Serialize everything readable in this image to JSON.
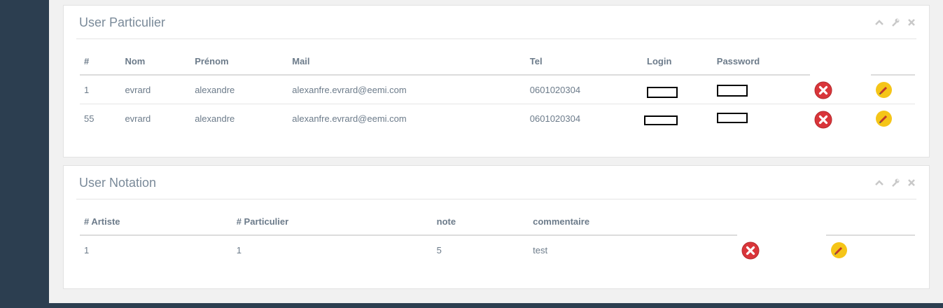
{
  "panels": [
    {
      "title": "User Particulier",
      "tools": [
        "chevron-up-icon",
        "wrench-icon",
        "close-icon"
      ],
      "columns": [
        "#",
        "Nom",
        "Prénom",
        "Mail",
        "Tel",
        "Login",
        "Password"
      ],
      "rows": [
        {
          "id": "1",
          "nom": "evrard",
          "prenom": "alexandre",
          "mail": "alexanfre.evrard@eemi.com",
          "tel": "0601020304"
        },
        {
          "id": "55",
          "nom": "evrard",
          "prenom": "alexandre",
          "mail": "alexanfre.evrard@eemi.com",
          "tel": "0601020304"
        }
      ]
    },
    {
      "title": "User Notation",
      "tools": [
        "chevron-up-icon",
        "wrench-icon",
        "close-icon"
      ],
      "columns": [
        "# Artiste",
        "# Particulier",
        "note",
        "commentaire"
      ],
      "rows": [
        {
          "artiste": "1",
          "particulier": "1",
          "note": "5",
          "commentaire": "test"
        }
      ]
    }
  ],
  "colors": {
    "sidebar": "#2c3e50",
    "delete": "#d9353a",
    "edit": "#f5c518",
    "text": "#6c7b8a"
  },
  "icons": {
    "delete": "delete-x-icon",
    "edit": "pencil-edit-icon"
  }
}
